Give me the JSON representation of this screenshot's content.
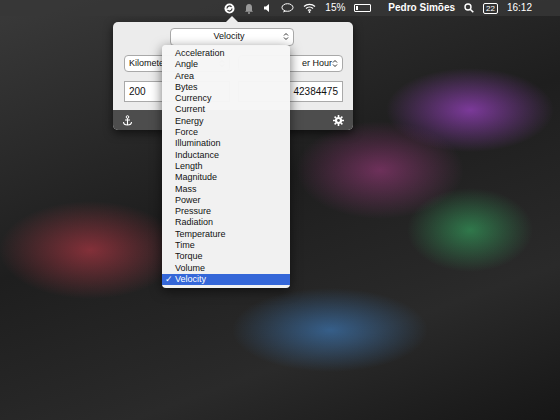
{
  "menu_bar": {
    "battery": "15%",
    "battery_level": 0.15,
    "user": "Pedro Simões",
    "calendar_day": "22",
    "time": "16:12"
  },
  "converter": {
    "category": "Velocity",
    "from_unit": "Kilomete",
    "to_unit": "er Hour",
    "from_value": "200",
    "to_value": "42384475",
    "menu": {
      "open": true,
      "check": "✓",
      "items": [
        {
          "label": "Acceleration",
          "selected": false
        },
        {
          "label": "Angle",
          "selected": false
        },
        {
          "label": "Area",
          "selected": false
        },
        {
          "label": "Bytes",
          "selected": false
        },
        {
          "label": "Currency",
          "selected": false
        },
        {
          "label": "Current",
          "selected": false
        },
        {
          "label": "Energy",
          "selected": false
        },
        {
          "label": "Force",
          "selected": false
        },
        {
          "label": "Illumination",
          "selected": false
        },
        {
          "label": "Inductance",
          "selected": false
        },
        {
          "label": "Length",
          "selected": false
        },
        {
          "label": "Magnitude",
          "selected": false
        },
        {
          "label": "Mass",
          "selected": false
        },
        {
          "label": "Power",
          "selected": false
        },
        {
          "label": "Pressure",
          "selected": false
        },
        {
          "label": "Radiation",
          "selected": false
        },
        {
          "label": "Temperature",
          "selected": false
        },
        {
          "label": "Time",
          "selected": false
        },
        {
          "label": "Torque",
          "selected": false
        },
        {
          "label": "Volume",
          "selected": false
        },
        {
          "label": "Velocity",
          "selected": true
        }
      ]
    }
  }
}
